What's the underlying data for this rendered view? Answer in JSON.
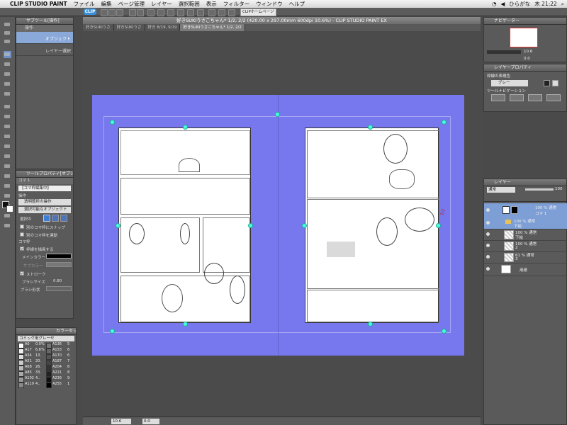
{
  "menubar": {
    "app": "CLIP STUDIO PAINT",
    "menus": [
      "ファイル",
      "編集",
      "ページ管理",
      "レイヤー",
      "選択範囲",
      "表示",
      "フィルター",
      "ウィンドウ",
      "ヘルプ"
    ],
    "input_method": "ひらがな",
    "clock": "木 21:22"
  },
  "toolbar": {
    "clip_button": "CLIP",
    "home_button": "CLIPホームページ"
  },
  "sub_tool_panel": {
    "title": "サブツール[操作]",
    "group": "操作",
    "items": [
      "オブジェクト",
      "レイヤー選択"
    ]
  },
  "tool_property": {
    "title": "ツールプロパティ[オブジェ",
    "tab": "コマ 1",
    "header": "【コマ枠編集中】",
    "section_operation": "操作",
    "operation_value": "透明箇所の操作",
    "select_value": "選択可能なオブジェクト",
    "selection_label": "選択の",
    "snap_other": "別のコマ枠にスナップ",
    "link_other": "別のコマ枠を連動",
    "section_frame": "コマ枠",
    "draw_frame": "枠線を描画する",
    "main_color": "メインカラー",
    "sub_color": "サブカラー",
    "stroke": "ストローク",
    "brush_size": "ブラシサイズ",
    "brush_size_value": "0.80",
    "brush_shape": "ブラシ形状"
  },
  "color_set": {
    "title": "カラーセット",
    "set_name": "コミック用グレーセ",
    "rows": [
      {
        "a": "A0",
        "av": "0.0%",
        "b": "A136",
        "bv": "5"
      },
      {
        "a": "A17",
        "av": "6.6%",
        "b": "A153",
        "bv": "6"
      },
      {
        "a": "A34",
        "av": "13.",
        "b": "A170",
        "bv": "6"
      },
      {
        "a": "A51",
        "av": "20.",
        "b": "A187",
        "bv": "7"
      },
      {
        "a": "A68",
        "av": "26.",
        "b": "A204",
        "bv": "8"
      },
      {
        "a": "A85",
        "av": "33.",
        "b": "A221",
        "bv": "8"
      },
      {
        "a": "A102",
        "av": "4..",
        "b": "A239",
        "bv": "9"
      },
      {
        "a": "A119",
        "av": "4..",
        "b": "A255",
        "bv": "1"
      }
    ]
  },
  "document": {
    "title": "好きSUKIうさこちゃん* 1/2, 2/2 (420.00 x 297.00mm 600dpi 10.6%) - CLIP STUDIO PAINT EX",
    "tabs": [
      "好きSUKIうさ",
      "好きSUKIうさ",
      "好き 8/19, 9/19",
      "好きSUKIうさこちゃん* 1/2, 2/2"
    ],
    "zoom": "10.6",
    "angle": "0.0"
  },
  "navigator": {
    "title": "ナビゲーター",
    "zoom": "10.6",
    "angle": "0.0"
  },
  "layer_property": {
    "title": "レイヤープロパティ",
    "expression_color_label": "枠線の表現色",
    "expression_color_value": "グレー",
    "tool_navigation_label": "ツールナビゲーション"
  },
  "layers": {
    "title": "レイヤー",
    "blend_mode": "通常",
    "opacity": "100",
    "items": [
      {
        "line1": "100 % 通常",
        "line2": "コマ 1",
        "type": "frame"
      },
      {
        "line1": "100 % 通常",
        "line2": "下絵",
        "type": "folder"
      },
      {
        "line1": "100 % 通常",
        "line2": "下絵",
        "type": "raster"
      },
      {
        "line1": "100 % 通常",
        "line2": "2",
        "type": "raster"
      },
      {
        "line1": "61 % 通常",
        "line2": "3",
        "type": "raster"
      },
      {
        "line1": "用紙",
        "line2": "",
        "type": "paper"
      }
    ]
  },
  "page_annotation": "1/2"
}
